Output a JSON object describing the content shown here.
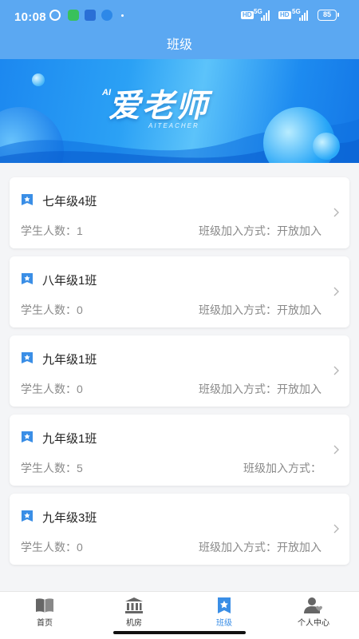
{
  "status_bar": {
    "time": "10:08",
    "network_1": "5G",
    "network_2": "5G",
    "hd_1": "HD",
    "hd_2": "HD",
    "battery": "85"
  },
  "header": {
    "title": "班级"
  },
  "banner": {
    "ai": "AI",
    "brand": "爱老师",
    "subtitle": "AITEACHER"
  },
  "classes": [
    {
      "name": "七年级4班",
      "count_label": "学生人数：1",
      "join_label": "班级加入方式：开放加入"
    },
    {
      "name": "八年级1班",
      "count_label": "学生人数：0",
      "join_label": "班级加入方式：开放加入"
    },
    {
      "name": "九年级1班",
      "count_label": "学生人数：0",
      "join_label": "班级加入方式：开放加入"
    },
    {
      "name": "九年级1班",
      "count_label": "学生人数：5",
      "join_label": "班级加入方式："
    },
    {
      "name": "九年级3班",
      "count_label": "学生人数：0",
      "join_label": "班级加入方式：开放加入"
    }
  ],
  "nav": [
    {
      "label": "首页",
      "icon": "book-icon"
    },
    {
      "label": "机房",
      "icon": "building-icon"
    },
    {
      "label": "班级",
      "icon": "star-bookmark-icon",
      "active": true
    },
    {
      "label": "个人中心",
      "icon": "user-heart-icon"
    }
  ],
  "colors": {
    "accent": "#3a8ee6",
    "header": "#5ba8f2"
  }
}
